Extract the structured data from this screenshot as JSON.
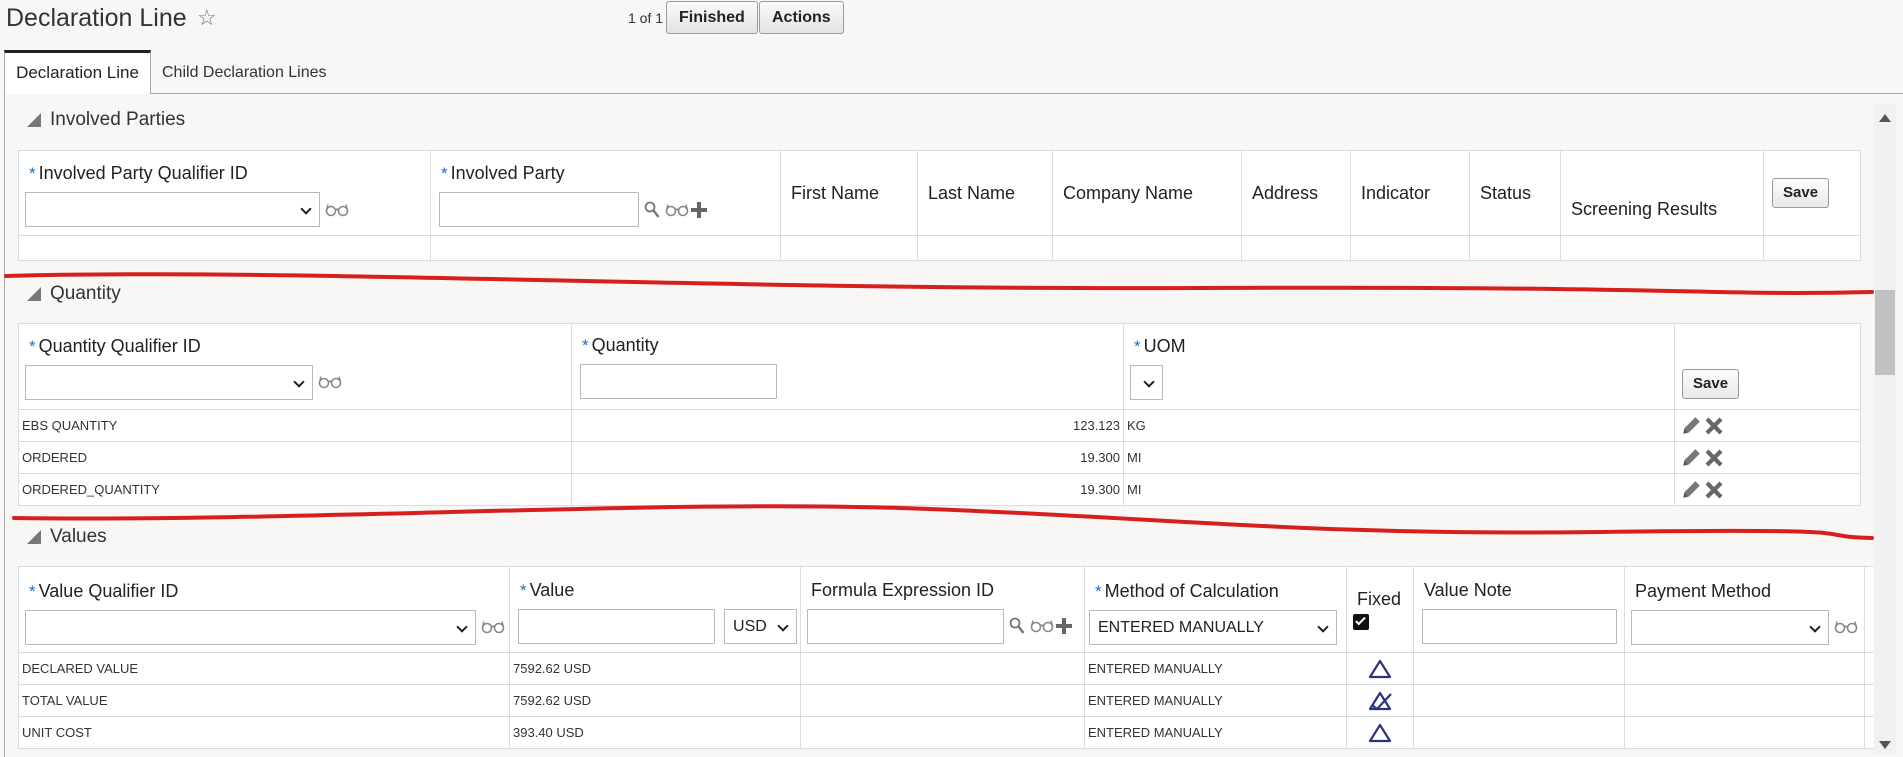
{
  "header": {
    "title": "Declaration Line",
    "pager": "1 of 1",
    "finished_label": "Finished",
    "actions_label": "Actions"
  },
  "tabs": [
    {
      "label": "Declaration Line",
      "active": true
    },
    {
      "label": "Child Declaration Lines",
      "active": false
    }
  ],
  "involved_parties": {
    "title": "Involved Parties",
    "columns": {
      "qualifier": "Involved Party Qualifier ID",
      "party": "Involved Party",
      "first_name": "First Name",
      "last_name": "Last Name",
      "company_name": "Company Name",
      "address": "Address",
      "indicator": "Indicator",
      "status": "Status",
      "screening_results": "Screening Results"
    },
    "save_label": "Save"
  },
  "quantity": {
    "title": "Quantity",
    "columns": {
      "qualifier": "Quantity Qualifier ID",
      "quantity": "Quantity",
      "uom": "UOM"
    },
    "save_label": "Save",
    "rows": [
      {
        "qualifier": "EBS QUANTITY",
        "quantity": "123.123",
        "uom": "KG"
      },
      {
        "qualifier": "ORDERED",
        "quantity": "19.300",
        "uom": "MI"
      },
      {
        "qualifier": "ORDERED_QUANTITY",
        "quantity": "19.300",
        "uom": "MI"
      }
    ]
  },
  "values": {
    "title": "Values",
    "columns": {
      "qualifier": "Value Qualifier ID",
      "value": "Value",
      "formula": "Formula Expression ID",
      "method": "Method of Calculation",
      "fixed": "Fixed",
      "value_note": "Value Note",
      "payment_method": "Payment Method"
    },
    "currency_selected": "USD",
    "method_selected": "ENTERED MANUALLY",
    "fixed_checked": true,
    "rows": [
      {
        "qualifier": "DECLARED VALUE",
        "value": "7592.62 USD",
        "method": "ENTERED MANUALLY",
        "fixed_icon": "delta-icon"
      },
      {
        "qualifier": "TOTAL VALUE",
        "value": "7592.62 USD",
        "method": "ENTERED MANUALLY",
        "fixed_icon": "delta-check-icon"
      },
      {
        "qualifier": "UNIT COST",
        "value": "393.40 USD",
        "method": "ENTERED MANUALLY",
        "fixed_icon": "delta-icon"
      }
    ]
  },
  "colors": {
    "required_asterisk": "#1a6fd1",
    "annotation_red": "#d62020",
    "icon_navy": "#2a3480"
  }
}
